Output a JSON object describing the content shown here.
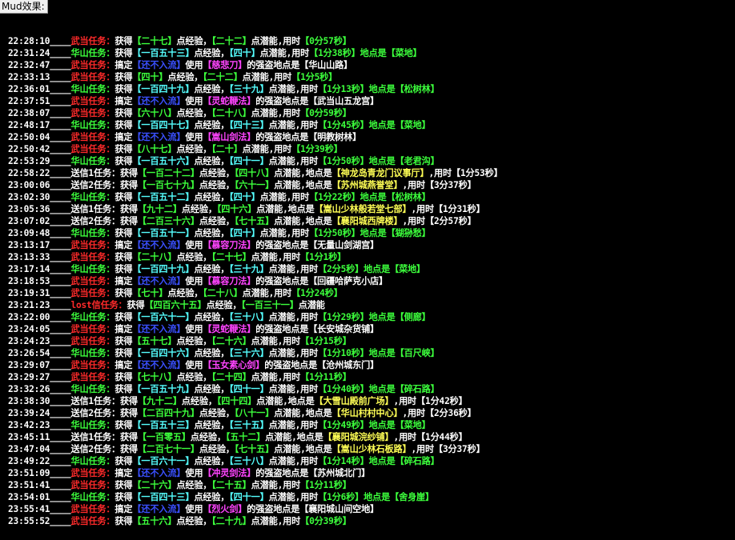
{
  "window": {
    "title": "Mud效果:"
  },
  "colors": {
    "time": "#ffffff",
    "sep": "#ffffff",
    "wudang": "#ff2a2a",
    "huashan": "#3cff3c",
    "send": "#ffffff",
    "lost": "#ff2a2a",
    "text": "#ffffff",
    "number": "#3cff3c",
    "number_alt": "#55ffff",
    "enemy": "#3a50ff",
    "skill": "#ff44ff",
    "place": "#ffffff",
    "place_huashan": "#3cff3c",
    "place_send": "#ffff55"
  },
  "lines": [
    {
      "time": "22:28:10",
      "type": "wudang",
      "label": "武当任务：",
      "kind": "reward",
      "exp": "二十七",
      "pot": "二十二",
      "dur": "0分57秒"
    },
    {
      "time": "22:31:24",
      "type": "huashan",
      "label": "华山任务：",
      "kind": "hs",
      "exp": "一百五十三",
      "pot": "四十",
      "dur": "1分38秒",
      "place": "菜地"
    },
    {
      "time": "22:32:47",
      "type": "wudang",
      "label": "武当任务：",
      "kind": "enemy",
      "enemy": "还不入流",
      "skill": "慈悲刀",
      "place": "华山山路"
    },
    {
      "time": "22:33:13",
      "type": "wudang",
      "label": "武当任务：",
      "kind": "reward",
      "exp": "四十",
      "pot": "二十二",
      "dur": "1分5秒"
    },
    {
      "time": "22:36:01",
      "type": "huashan",
      "label": "华山任务：",
      "kind": "hs",
      "exp": "一百四十九",
      "pot": "三十九",
      "dur": "1分13秒",
      "place": "松树林"
    },
    {
      "time": "22:37:51",
      "type": "wudang",
      "label": "武当任务：",
      "kind": "enemy",
      "enemy": "还不入流",
      "skill": "灵蛇鞭法",
      "place": "武当山五龙宫"
    },
    {
      "time": "22:38:07",
      "type": "wudang",
      "label": "武当任务：",
      "kind": "reward",
      "exp": "六十八",
      "pot": "二十八",
      "dur": "0分59秒"
    },
    {
      "time": "22:48:17",
      "type": "huashan",
      "label": "华山任务：",
      "kind": "hs",
      "exp": "一百四十七",
      "pot": "四十三",
      "dur": "1分45秒",
      "place": "菜地"
    },
    {
      "time": "22:50:04",
      "type": "wudang",
      "label": "武当任务：",
      "kind": "enemy",
      "enemy": "还不入流",
      "skill": "嵩山剑法",
      "place": "明教树林"
    },
    {
      "time": "22:50:42",
      "type": "wudang",
      "label": "武当任务：",
      "kind": "reward",
      "exp": "八十七",
      "pot": "二十",
      "dur": "1分39秒"
    },
    {
      "time": "22:53:29",
      "type": "huashan",
      "label": "华山任务：",
      "kind": "hs",
      "exp": "一百五十六",
      "pot": "四十一",
      "dur": "1分50秒",
      "place": "老君沟"
    },
    {
      "time": "22:58:22",
      "type": "send",
      "label": "送信1任务：",
      "kind": "send",
      "exp": "一百二十二",
      "pot": "四十八",
      "place": "神龙岛青龙门议事厅",
      "dur": "1分53秒"
    },
    {
      "time": "23:00:06",
      "type": "send",
      "label": "送信2任务：",
      "kind": "send",
      "exp": "一百七十九",
      "pot": "六十一",
      "place": "苏州城燕誉堂",
      "dur": "3分37秒"
    },
    {
      "time": "23:02:30",
      "type": "huashan",
      "label": "华山任务：",
      "kind": "hs",
      "exp": "一百五十二",
      "pot": "四十",
      "dur": "1分22秒",
      "place": "松树林"
    },
    {
      "time": "23:05:36",
      "type": "send",
      "label": "送信1任务：",
      "kind": "send",
      "exp": "九十二",
      "pot": "四十六",
      "place": "嵩山少林般若堂七部",
      "dur": "1分31秒"
    },
    {
      "time": "23:07:02",
      "type": "send",
      "label": "送信2任务：",
      "kind": "send",
      "exp": "二百三十六",
      "pot": "七十五",
      "place": "襄阳城西牌楼",
      "dur": "2分57秒"
    },
    {
      "time": "23:09:48",
      "type": "huashan",
      "label": "华山任务：",
      "kind": "hs",
      "exp": "一百五十一",
      "pot": "四十",
      "dur": "1分50秒",
      "place": "猢狲愁"
    },
    {
      "time": "23:13:17",
      "type": "wudang",
      "label": "武当任务：",
      "kind": "enemy",
      "enemy": "还不入流",
      "skill": "慕容刀法",
      "place": "无量山剑湖宫"
    },
    {
      "time": "23:13:33",
      "type": "wudang",
      "label": "武当任务：",
      "kind": "reward",
      "exp": "二十八",
      "pot": "二十七",
      "dur": "1分1秒"
    },
    {
      "time": "23:17:14",
      "type": "huashan",
      "label": "华山任务：",
      "kind": "hs",
      "exp": "一百四十九",
      "pot": "三十九",
      "dur": "2分5秒",
      "place": "菜地"
    },
    {
      "time": "23:18:53",
      "type": "wudang",
      "label": "武当任务：",
      "kind": "enemy",
      "enemy": "还不入流",
      "skill": "慕容刀法",
      "place": "回疆哈萨克小店"
    },
    {
      "time": "23:19:31",
      "type": "wudang",
      "label": "武当任务：",
      "kind": "reward",
      "exp": "七十",
      "pot": "二十八",
      "dur": "1分24秒"
    },
    {
      "time": "23:21:23",
      "type": "lost",
      "label": "lost信任务：",
      "kind": "lost",
      "exp": "四百六十五",
      "pot": "一百三十一"
    },
    {
      "time": "23:22:00",
      "type": "huashan",
      "label": "华山任务：",
      "kind": "hs",
      "exp": "一百六十一",
      "pot": "三十八",
      "dur": "1分29秒",
      "place": "侧廊"
    },
    {
      "time": "23:24:05",
      "type": "wudang",
      "label": "武当任务：",
      "kind": "enemy",
      "enemy": "还不入流",
      "skill": "灵蛇鞭法",
      "place": "长安城杂货铺"
    },
    {
      "time": "23:24:23",
      "type": "wudang",
      "label": "武当任务：",
      "kind": "reward",
      "exp": "五十七",
      "pot": "二十六",
      "dur": "1分15秒"
    },
    {
      "time": "23:26:54",
      "type": "huashan",
      "label": "华山任务：",
      "kind": "hs",
      "exp": "一百四十六",
      "pot": "三十六",
      "dur": "1分10秒",
      "place": "百尺峡"
    },
    {
      "time": "23:29:07",
      "type": "wudang",
      "label": "武当任务：",
      "kind": "enemy",
      "enemy": "还不入流",
      "skill": "玉女素心剑",
      "place": "沧州城东门"
    },
    {
      "time": "23:29:27",
      "type": "wudang",
      "label": "武当任务：",
      "kind": "reward",
      "exp": "七十八",
      "pot": "二十四",
      "dur": "1分11秒"
    },
    {
      "time": "23:32:26",
      "type": "huashan",
      "label": "华山任务：",
      "kind": "hs",
      "exp": "一百五十九",
      "pot": "四十一",
      "dur": "1分40秒",
      "place": "碎石路"
    },
    {
      "time": "23:38:30",
      "type": "send",
      "label": "送信1任务：",
      "kind": "send",
      "exp": "九十二",
      "pot": "四十四",
      "place": "大雪山殿前广场",
      "dur": "1分42秒"
    },
    {
      "time": "23:39:24",
      "type": "send",
      "label": "送信2任务：",
      "kind": "send",
      "exp": "二百四十九",
      "pot": "八十一",
      "place": "华山村村中心",
      "dur": "2分36秒"
    },
    {
      "time": "23:42:23",
      "type": "huashan",
      "label": "华山任务：",
      "kind": "hs",
      "exp": "一百五十三",
      "pot": "三十五",
      "dur": "1分49秒",
      "place": "菜地"
    },
    {
      "time": "23:45:11",
      "type": "send",
      "label": "送信1任务：",
      "kind": "send",
      "exp": "一百零五",
      "pot": "五十二",
      "place": "襄阳城浣纱铺",
      "dur": "1分44秒"
    },
    {
      "time": "23:47:04",
      "type": "send",
      "label": "送信2任务：",
      "kind": "send",
      "exp": "二百七十一",
      "pot": "七十五",
      "place": "嵩山少林石板路",
      "dur": "3分37秒"
    },
    {
      "time": "23:49:22",
      "type": "huashan",
      "label": "华山任务：",
      "kind": "hs",
      "exp": "一百六十一",
      "pot": "三十八",
      "dur": "1分14秒",
      "place": "碎石路"
    },
    {
      "time": "23:51:09",
      "type": "wudang",
      "label": "武当任务：",
      "kind": "enemy",
      "enemy": "还不入流",
      "skill": "冲灵剑法",
      "place": "苏州城北门"
    },
    {
      "time": "23:51:41",
      "type": "wudang",
      "label": "武当任务：",
      "kind": "reward",
      "exp": "二十六",
      "pot": "二十五",
      "dur": "1分11秒"
    },
    {
      "time": "23:54:01",
      "type": "huashan",
      "label": "华山任务：",
      "kind": "hs",
      "exp": "一百四十三",
      "pot": "四十一",
      "dur": "1分6秒",
      "place": "舍身崖"
    },
    {
      "time": "23:55:41",
      "type": "wudang",
      "label": "武当任务：",
      "kind": "enemy",
      "enemy": "还不入流",
      "skill": "烈火剑",
      "place": "襄阳城山间空地"
    },
    {
      "time": "23:55:52",
      "type": "wudang",
      "label": "武当任务：",
      "kind": "reward",
      "exp": "五十六",
      "pot": "二十九",
      "dur": "0分39秒"
    }
  ]
}
